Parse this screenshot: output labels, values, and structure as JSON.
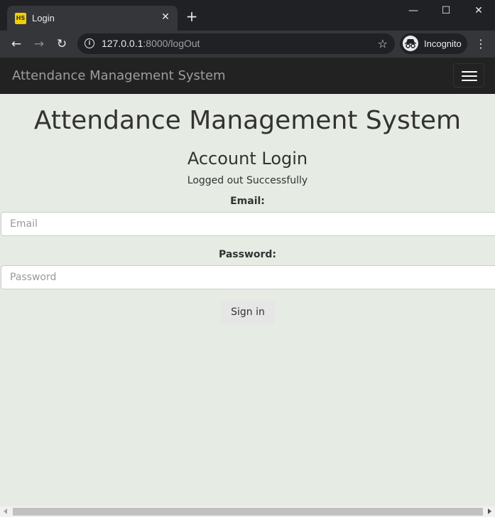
{
  "browser": {
    "tab_title": "Login",
    "favicon_text": "HS",
    "new_tab": "+",
    "url_host": "127.0.0.1",
    "url_rest": ":8000/logOut",
    "incognito_label": "Incognito"
  },
  "navbar": {
    "brand": "Attendance Management System"
  },
  "main": {
    "heading": "Attendance Management System",
    "subheading": "Account Login",
    "message": "Logged out Successfully",
    "email_label": "Email:",
    "email_placeholder": "Email",
    "password_label": "Password:",
    "password_placeholder": "Password",
    "signin_label": "Sign in"
  },
  "icons": {
    "back": "arrow-left-icon",
    "forward": "arrow-right-icon",
    "reload": "reload-icon",
    "info": "info-icon",
    "star": "star-icon",
    "incognito": "incognito-icon",
    "menu": "kebab-menu-icon",
    "hamburger": "hamburger-icon"
  },
  "colors": {
    "page_background": "#e6ece4",
    "navbar_background": "#222222",
    "brand_text": "#9d9d9d"
  }
}
